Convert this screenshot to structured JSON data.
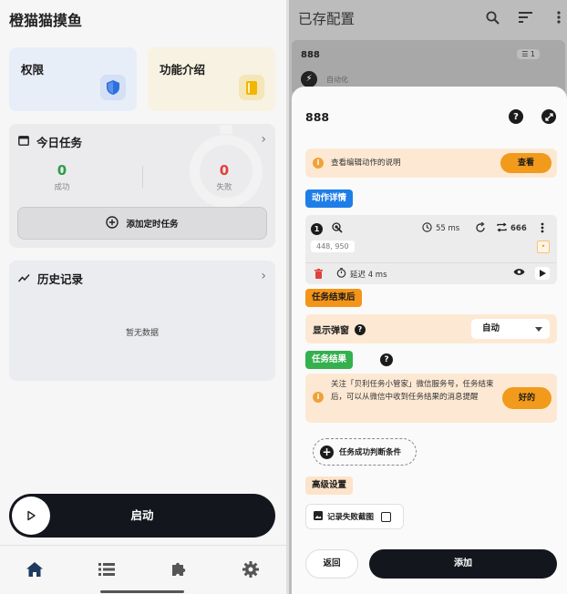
{
  "left": {
    "app_title": "橙猫猫摸鱼",
    "permissions_title": "权限",
    "features_title": "功能介绍",
    "today": {
      "title": "今日任务",
      "success_count": "0",
      "success_label": "成功",
      "fail_count": "0",
      "fail_label": "失败",
      "add_button": "添加定时任务"
    },
    "history": {
      "title": "历史记录",
      "empty_text": "暂无数据"
    },
    "start_label": "启动",
    "tabs": [
      "home-icon",
      "list-icon",
      "puzzle-icon",
      "gear-icon"
    ]
  },
  "right": {
    "title": "已存配置",
    "bg_item": {
      "name": "888",
      "badge": "1",
      "mode": "自动化"
    },
    "sheet": {
      "config_name": "888",
      "info_text": "查看编辑动作的说明",
      "view_button": "查看",
      "action_tag": "动作详情",
      "action": {
        "index": "1",
        "duration": "55 ms",
        "repeat": "666",
        "coords": "448, 950",
        "delay": "延迟 4 ms"
      },
      "after_tag": "任务结束后",
      "popup_label": "显示弹窗",
      "popup_value": "自动",
      "result_tag": "任务结果",
      "notice_text": "关注「贝利任务小管家」微信服务号，任务结束后，可以从微信中收到任务结果的消息提醒",
      "ok_button": "好的",
      "add_condition": "任务成功判断条件",
      "advanced_tag": "高级设置",
      "screenshot_label": "记录失败截图",
      "back_button": "返回",
      "add_button": "添加"
    }
  },
  "colors": {
    "accent_orange": "#f29a1b",
    "accent_blue": "#1e7ee8",
    "accent_green": "#34b04f",
    "dark": "#14161e"
  }
}
